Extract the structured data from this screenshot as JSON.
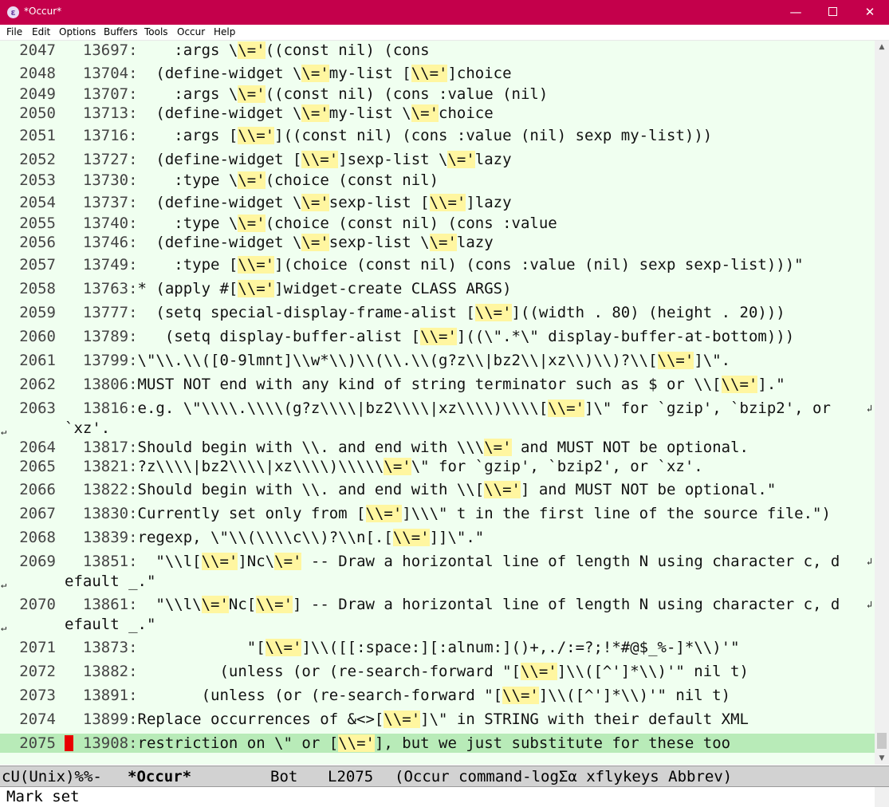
{
  "window": {
    "title": "*Occur*",
    "app_icon": "emacs-icon",
    "minimize_glyph": "—",
    "close_glyph": "✕"
  },
  "menu": [
    "File",
    "Edit",
    "Options",
    "Buffers",
    "Tools",
    "Occur",
    "Help"
  ],
  "colors": {
    "titlebar": "#c4004b",
    "editor_bg": "#f0fff0",
    "match_highlight": "#fff6a0",
    "current_line": "#b8ebb8",
    "cursor": "#e80000"
  },
  "lines": [
    {
      "n": "2047",
      "src": "13697:",
      "segs": [
        {
          "t": "    :args \\"
        },
        {
          "t": "\\='",
          "h": 1
        },
        {
          "t": "((const nil) (cons"
        }
      ]
    },
    {
      "n": "2048",
      "src": "13704:",
      "segs": [
        {
          "t": "  (define-widget \\"
        },
        {
          "t": "\\='",
          "h": 1
        },
        {
          "t": "my-list ["
        },
        {
          "t": "\\\\='",
          "h": 1
        },
        {
          "t": "]choice"
        }
      ]
    },
    {
      "n": "2049",
      "src": "13707:",
      "segs": [
        {
          "t": "    :args \\"
        },
        {
          "t": "\\='",
          "h": 1
        },
        {
          "t": "((const nil) (cons :value (nil)"
        }
      ]
    },
    {
      "n": "2050",
      "src": "13713:",
      "segs": [
        {
          "t": "  (define-widget \\"
        },
        {
          "t": "\\='",
          "h": 1
        },
        {
          "t": "my-list \\"
        },
        {
          "t": "\\='",
          "h": 1
        },
        {
          "t": "choice"
        }
      ]
    },
    {
      "n": "2051",
      "src": "13716:",
      "segs": [
        {
          "t": "    :args ["
        },
        {
          "t": "\\\\='",
          "h": 1
        },
        {
          "t": "]((const nil) (cons :value (nil) sexp my-list)))"
        }
      ]
    },
    {
      "n": "2052",
      "src": "13727:",
      "segs": [
        {
          "t": "  (define-widget ["
        },
        {
          "t": "\\\\='",
          "h": 1
        },
        {
          "t": "]sexp-list \\"
        },
        {
          "t": "\\='",
          "h": 1
        },
        {
          "t": "lazy"
        }
      ]
    },
    {
      "n": "2053",
      "src": "13730:",
      "segs": [
        {
          "t": "    :type \\"
        },
        {
          "t": "\\='",
          "h": 1
        },
        {
          "t": "(choice (const nil)"
        }
      ]
    },
    {
      "n": "2054",
      "src": "13737:",
      "segs": [
        {
          "t": "  (define-widget \\"
        },
        {
          "t": "\\='",
          "h": 1
        },
        {
          "t": "sexp-list ["
        },
        {
          "t": "\\\\='",
          "h": 1
        },
        {
          "t": "]lazy"
        }
      ]
    },
    {
      "n": "2055",
      "src": "13740:",
      "segs": [
        {
          "t": "    :type \\"
        },
        {
          "t": "\\='",
          "h": 1
        },
        {
          "t": "(choice (const nil) (cons :value"
        }
      ]
    },
    {
      "n": "2056",
      "src": "13746:",
      "segs": [
        {
          "t": "  (define-widget \\"
        },
        {
          "t": "\\='",
          "h": 1
        },
        {
          "t": "sexp-list \\"
        },
        {
          "t": "\\='",
          "h": 1
        },
        {
          "t": "lazy"
        }
      ]
    },
    {
      "n": "2057",
      "src": "13749:",
      "segs": [
        {
          "t": "    :type ["
        },
        {
          "t": "\\\\='",
          "h": 1
        },
        {
          "t": "](choice (const nil) (cons :value (nil) sexp sexp-list)))\""
        }
      ]
    },
    {
      "n": "2058",
      "src": "13763:",
      "segs": [
        {
          "t": "* (apply #["
        },
        {
          "t": "\\\\='",
          "h": 1
        },
        {
          "t": "]widget-create CLASS ARGS)"
        }
      ]
    },
    {
      "n": "2059",
      "src": "13777:",
      "segs": [
        {
          "t": "  (setq special-display-frame-alist ["
        },
        {
          "t": "\\\\='",
          "h": 1
        },
        {
          "t": "]((width . 80) (height . 20)))"
        }
      ]
    },
    {
      "n": "2060",
      "src": "13789:",
      "segs": [
        {
          "t": "   (setq display-buffer-alist ["
        },
        {
          "t": "\\\\='",
          "h": 1
        },
        {
          "t": "]((\\\".*\\\" display-buffer-at-bottom)))"
        }
      ]
    },
    {
      "n": "2061",
      "src": "13799:",
      "segs": [
        {
          "t": "\\\"\\\\.\\\\([0-9lmnt]\\\\w*\\\\)\\\\(\\\\.\\\\(g?z\\\\|bz2\\\\|xz\\\\)\\\\)?\\\\["
        },
        {
          "t": "\\\\='",
          "h": 1
        },
        {
          "t": "]\\\"."
        }
      ]
    },
    {
      "n": "2062",
      "src": "13806:",
      "segs": [
        {
          "t": "MUST NOT end with any kind of string terminator such as $ or \\\\["
        },
        {
          "t": "\\\\='",
          "h": 1
        },
        {
          "t": "].\""
        }
      ]
    },
    {
      "n": "2063",
      "src": "13816:",
      "segs": [
        {
          "t": "e.g. \\\"\\\\\\\\.\\\\\\\\(g?z\\\\\\\\|bz2\\\\\\\\|xz\\\\\\\\)\\\\\\\\["
        },
        {
          "t": "\\\\='",
          "h": 1
        },
        {
          "t": "]\\\" for `gzip', `bzip2', or"
        }
      ],
      "wrap": "`xz'."
    },
    {
      "n": "2064",
      "src": "13817:",
      "segs": [
        {
          "t": "Should begin with \\\\. and end with \\\\\\"
        },
        {
          "t": "\\='",
          "h": 1
        },
        {
          "t": " and MUST NOT be optional."
        }
      ]
    },
    {
      "n": "2065",
      "src": "13821:",
      "segs": [
        {
          "t": "?z\\\\\\\\|bz2\\\\\\\\|xz\\\\\\\\)\\\\\\\\\\"
        },
        {
          "t": "\\='",
          "h": 1
        },
        {
          "t": "\\\" for `gzip', `bzip2', or `xz'."
        }
      ]
    },
    {
      "n": "2066",
      "src": "13822:",
      "segs": [
        {
          "t": "Should begin with \\\\. and end with \\\\["
        },
        {
          "t": "\\\\='",
          "h": 1
        },
        {
          "t": "] and MUST NOT be optional.\""
        }
      ]
    },
    {
      "n": "2067",
      "src": "13830:",
      "segs": [
        {
          "t": "Currently set only from ["
        },
        {
          "t": "\\\\='",
          "h": 1
        },
        {
          "t": "]\\\\\\\" t in the first line of the source file.\")"
        }
      ]
    },
    {
      "n": "2068",
      "src": "13839:",
      "segs": [
        {
          "t": "regexp, \\\"\\\\(\\\\\\\\c\\\\)?\\\\n[.["
        },
        {
          "t": "\\\\='",
          "h": 1
        },
        {
          "t": "]]\\\".\""
        }
      ]
    },
    {
      "n": "2069",
      "src": "13851:",
      "segs": [
        {
          "t": "  \"\\\\l["
        },
        {
          "t": "\\\\='",
          "h": 1
        },
        {
          "t": "]Nc\\"
        },
        {
          "t": "\\='",
          "h": 1
        },
        {
          "t": " -- Draw a horizontal line of length N using character c, d"
        }
      ],
      "wrap": "efault _.\""
    },
    {
      "n": "2070",
      "src": "13861:",
      "segs": [
        {
          "t": "  \"\\\\l\\"
        },
        {
          "t": "\\='",
          "h": 1
        },
        {
          "t": "Nc["
        },
        {
          "t": "\\\\='",
          "h": 1
        },
        {
          "t": "] -- Draw a horizontal line of length N using character c, d"
        }
      ],
      "wrap": "efault _.\""
    },
    {
      "n": "2071",
      "src": "13873:",
      "segs": [
        {
          "t": "            \"["
        },
        {
          "t": "\\\\='",
          "h": 1
        },
        {
          "t": "]\\\\([[:space:][:alnum:]()+,./:=?;!*#@$_%-]*\\\\)'\""
        }
      ]
    },
    {
      "n": "2072",
      "src": "13882:",
      "segs": [
        {
          "t": "         (unless (or (re-search-forward \"["
        },
        {
          "t": "\\\\='",
          "h": 1
        },
        {
          "t": "]\\\\([^']*\\\\)'\" nil t)"
        }
      ]
    },
    {
      "n": "2073",
      "src": "13891:",
      "segs": [
        {
          "t": "       (unless (or (re-search-forward \"["
        },
        {
          "t": "\\\\='",
          "h": 1
        },
        {
          "t": "]\\\\([^']*\\\\)'\" nil t)"
        }
      ]
    },
    {
      "n": "2074",
      "src": "13899:",
      "segs": [
        {
          "t": "Replace occurrences of &<>["
        },
        {
          "t": "\\\\='",
          "h": 1
        },
        {
          "t": "]\\\" in STRING with their default XML"
        }
      ]
    },
    {
      "n": "2075",
      "src": "13908:",
      "segs": [
        {
          "t": "restriction on \\\" or ["
        },
        {
          "t": "\\\\='",
          "h": 1
        },
        {
          "t": "], but we just substitute for these too"
        }
      ],
      "current": true
    }
  ],
  "modeline": {
    "status": "cU(Unix)%%-",
    "buffer": "*Occur*",
    "position": "Bot",
    "line": "L2075",
    "modes": "(Occur command-logΣα xflykeys Abbrev)"
  },
  "minibuffer": "Mark set",
  "fringe": {
    "wrap_glyph": "↵",
    "cont_glyph": "↲"
  }
}
